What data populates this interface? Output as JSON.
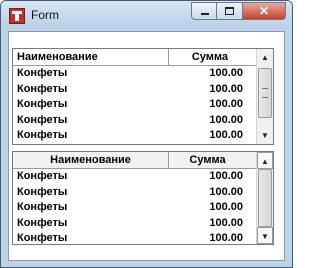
{
  "window": {
    "title": "Form",
    "minimize_glyph": "minimize-icon",
    "maximize_glyph": "maximize-icon",
    "close_label": "✕"
  },
  "grid_top": {
    "columns": [
      "Наименование",
      "Сумма"
    ],
    "rows": [
      {
        "name": "Конфеты",
        "sum": "100.00"
      },
      {
        "name": "Конфеты",
        "sum": "100.00"
      },
      {
        "name": "Конфеты",
        "sum": "100.00"
      },
      {
        "name": "Конфеты",
        "sum": "100.00"
      },
      {
        "name": "Конфеты",
        "sum": "100.00"
      }
    ]
  },
  "grid_bottom": {
    "columns": [
      "Наименование",
      "Сумма"
    ],
    "rows": [
      {
        "name": "Конфеты",
        "sum": "100.00"
      },
      {
        "name": "Конфеты",
        "sum": "100.00"
      },
      {
        "name": "Конфеты",
        "sum": "100.00"
      },
      {
        "name": "Конфеты",
        "sum": "100.00"
      },
      {
        "name": "Конфеты",
        "sum": "100.00"
      }
    ]
  },
  "scrollbar": {
    "up_arrow": "▲",
    "down_arrow": "▼"
  }
}
